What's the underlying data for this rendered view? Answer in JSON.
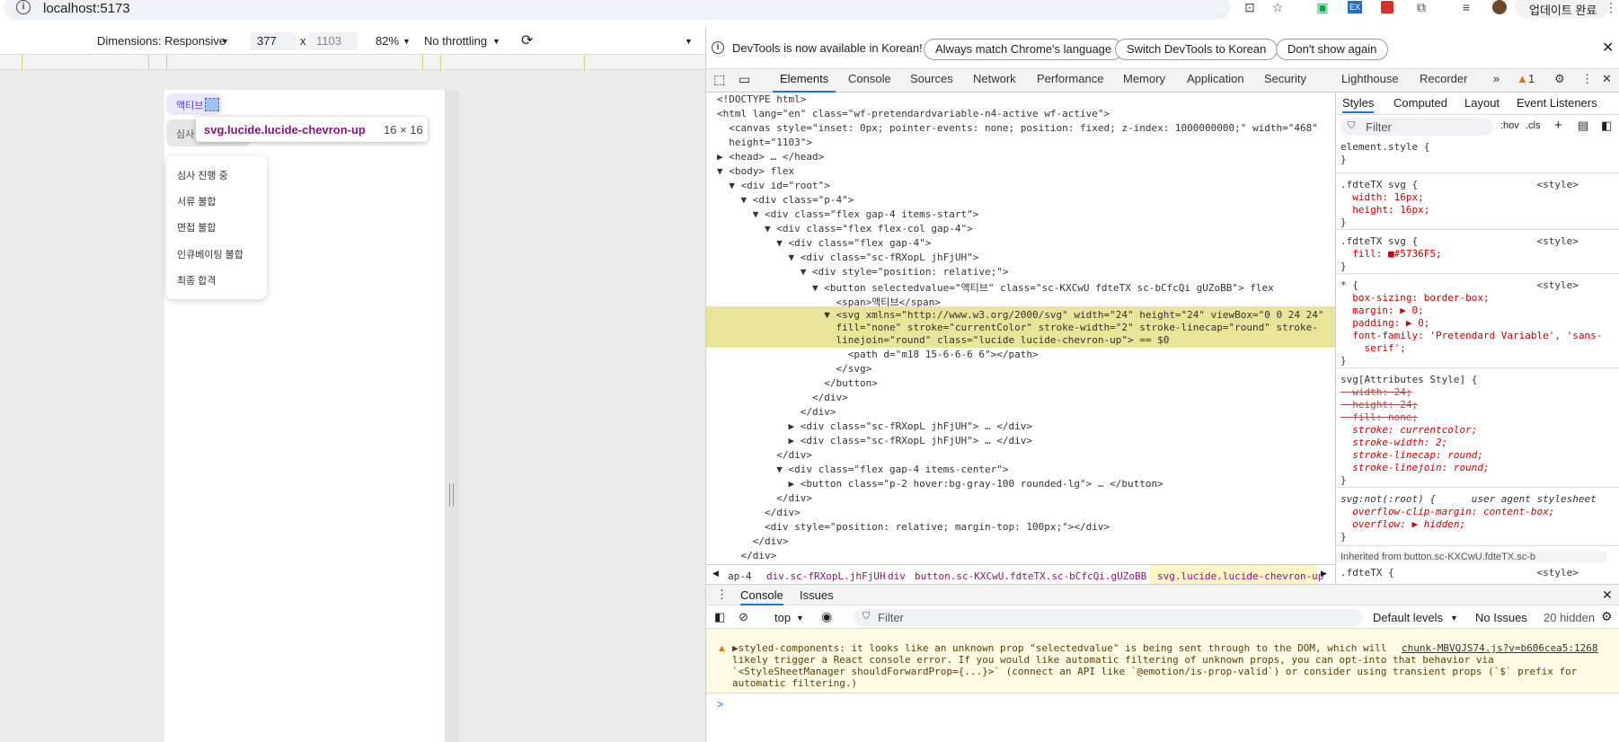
{
  "browser": {
    "url": "localhost:5173",
    "update_label": "업데이트 완료",
    "toolbar_icons": [
      "translate-icon",
      "star-icon",
      "extension-icon",
      "ex-extension-icon",
      "pdf-extension-icon",
      "puzzle-icon",
      "reading-list-icon",
      "profile-avatar-icon",
      "more-icon"
    ],
    "ex_label": "EX"
  },
  "device_toolbar": {
    "dimensions_label": "Dimensions: Responsive",
    "width": "377",
    "x": "x",
    "height": "1103",
    "zoom": "82%",
    "throttling": "No throttling"
  },
  "page": {
    "active_button_label": "액티브",
    "gray_button_label": "심사",
    "tooltip_selector": "svg.lucide.lucide-chevron-up",
    "tooltip_size": "16 × 16",
    "dropdown_items": [
      "심사 진행 중",
      "서류 불합",
      "면접 불합",
      "인큐베이팅 불합",
      "최종 합격"
    ]
  },
  "devtools": {
    "korean_notice": "DevTools is now available in Korean!",
    "korean_buttons": [
      "Always match Chrome's language",
      "Switch DevTools to Korean",
      "Don't show again"
    ],
    "tabs": [
      "Elements",
      "Console",
      "Sources",
      "Network",
      "Performance",
      "Memory",
      "Application",
      "Security",
      "Lighthouse",
      "Recorder"
    ],
    "warning_count": "1",
    "dom_lines": [
      "<!DOCTYPE html>",
      "<html lang=\"en\" class=\"wf-pretendardvariable-n4-active wf-active\">",
      "  <canvas style=\"inset: 0px; pointer-events: none; position: fixed; z-index: 1000000000;\" width=\"468\"",
      "  height=\"1103\">",
      "▶ <head> … </head>",
      "▼ <body> flex",
      "  ▼ <div id=\"root\">",
      "    ▼ <div class=\"p-4\">",
      "      ▼ <div class=\"flex gap-4 items-start\">",
      "        ▼ <div class=\"flex flex-col gap-4\">",
      "          ▼ <div class=\"flex gap-4\">",
      "            ▼ <div class=\"sc-fRXopL jhFjUH\">",
      "              ▼ <div style=\"position: relative;\">",
      "                ▼ <button selectedvalue=\"액티브\" class=\"sc-KXCwU fdteTX sc-bCfcQi gUZoBB\"> flex",
      "                    <span>액티브</span>",
      "                  ▼ <svg xmlns=\"http://www.w3.org/2000/svg\" width=\"24\" height=\"24\" viewBox=\"0 0 24 24\"",
      "                    fill=\"none\" stroke=\"currentColor\" stroke-width=\"2\" stroke-linecap=\"round\" stroke-",
      "                    linejoin=\"round\" class=\"lucide lucide-chevron-up\"> == $0",
      "                      <path d=\"m18 15-6-6-6 6\"></path>",
      "                    </svg>",
      "                  </button>",
      "                </div>",
      "              </div>",
      "            ▶ <div class=\"sc-fRXopL jhFjUH\"> … </div>",
      "            ▶ <div class=\"sc-fRXopL jhFjUH\"> … </div>",
      "          </div>",
      "          ▼ <div class=\"flex gap-4 items-center\">",
      "            ▶ <button class=\"p-2 hover:bg-gray-100 rounded-lg\"> … </button>",
      "          </div>",
      "        </div>",
      "        <div style=\"position: relative; margin-top: 100px;\"></div>",
      "      </div>",
      "    </div>"
    ],
    "breadcrumbs": [
      "ap-4",
      "div.sc-fRXopL.jhFjUH",
      "div",
      "button.sc-KXCwU.fdteTX.sc-bCfcQi.gUZoBB",
      "svg.lucide.lucide-chevron-up"
    ],
    "styles_tabs": [
      "Styles",
      "Computed",
      "Layout",
      "Event Listeners"
    ],
    "styles_filter_placeholder": "Filter",
    "hov": ":hov",
    "cls": ".cls",
    "style_rules": [
      "element.style {",
      "}",
      ".fdteTX svg {                    <style>",
      "  width: 16px;",
      "  height: 16px;",
      "}",
      ".fdteTX svg {                    <style>",
      "  fill: ■#5736F5;",
      "}",
      "* {                              <style>",
      "  box-sizing: border-box;",
      "  margin: ▶ 0;",
      "  padding: ▶ 0;",
      "  font-family: 'Pretendard Variable', 'sans-",
      "    serif';",
      "}",
      "svg[Attributes Style] {",
      "  width: 24;",
      "  height: 24;",
      "  fill: none;",
      "  stroke: currentcolor;",
      "  stroke-width: 2;",
      "  stroke-linecap: round;",
      "  stroke-linejoin: round;",
      "}",
      "svg:not(:root) {      user agent stylesheet",
      "  overflow-clip-margin: content-box;",
      "  overflow: ▶ hidden;",
      "}",
      "Inherited from button.sc-KXCwU.fdteTX.sc-b",
      ".fdteTX {                        <style>"
    ],
    "accent_color": "#5736F5",
    "console": {
      "tabs": [
        "Console",
        "Issues"
      ],
      "context": "top",
      "filter_placeholder": "Filter",
      "levels": "Default levels",
      "issues": "No Issues",
      "hidden": "20 hidden",
      "warning_lines": [
        "▶styled-components: it looks like an unknown prop \"selectedvalue\" is being sent through to the DOM, which will",
        "likely trigger a React console error. If you would like automatic filtering of unknown props, you can opt-into that behavior via",
        "`<StyleSheetManager shouldForwardProp={...}>` (connect an API like `@emotion/is-prop-valid`) or consider using transient props (`$` prefix for",
        "automatic filtering.)"
      ],
      "warning_source": "chunk-MBVQJS74.js?v=b606cea5:1268",
      "prompt": ">"
    }
  }
}
